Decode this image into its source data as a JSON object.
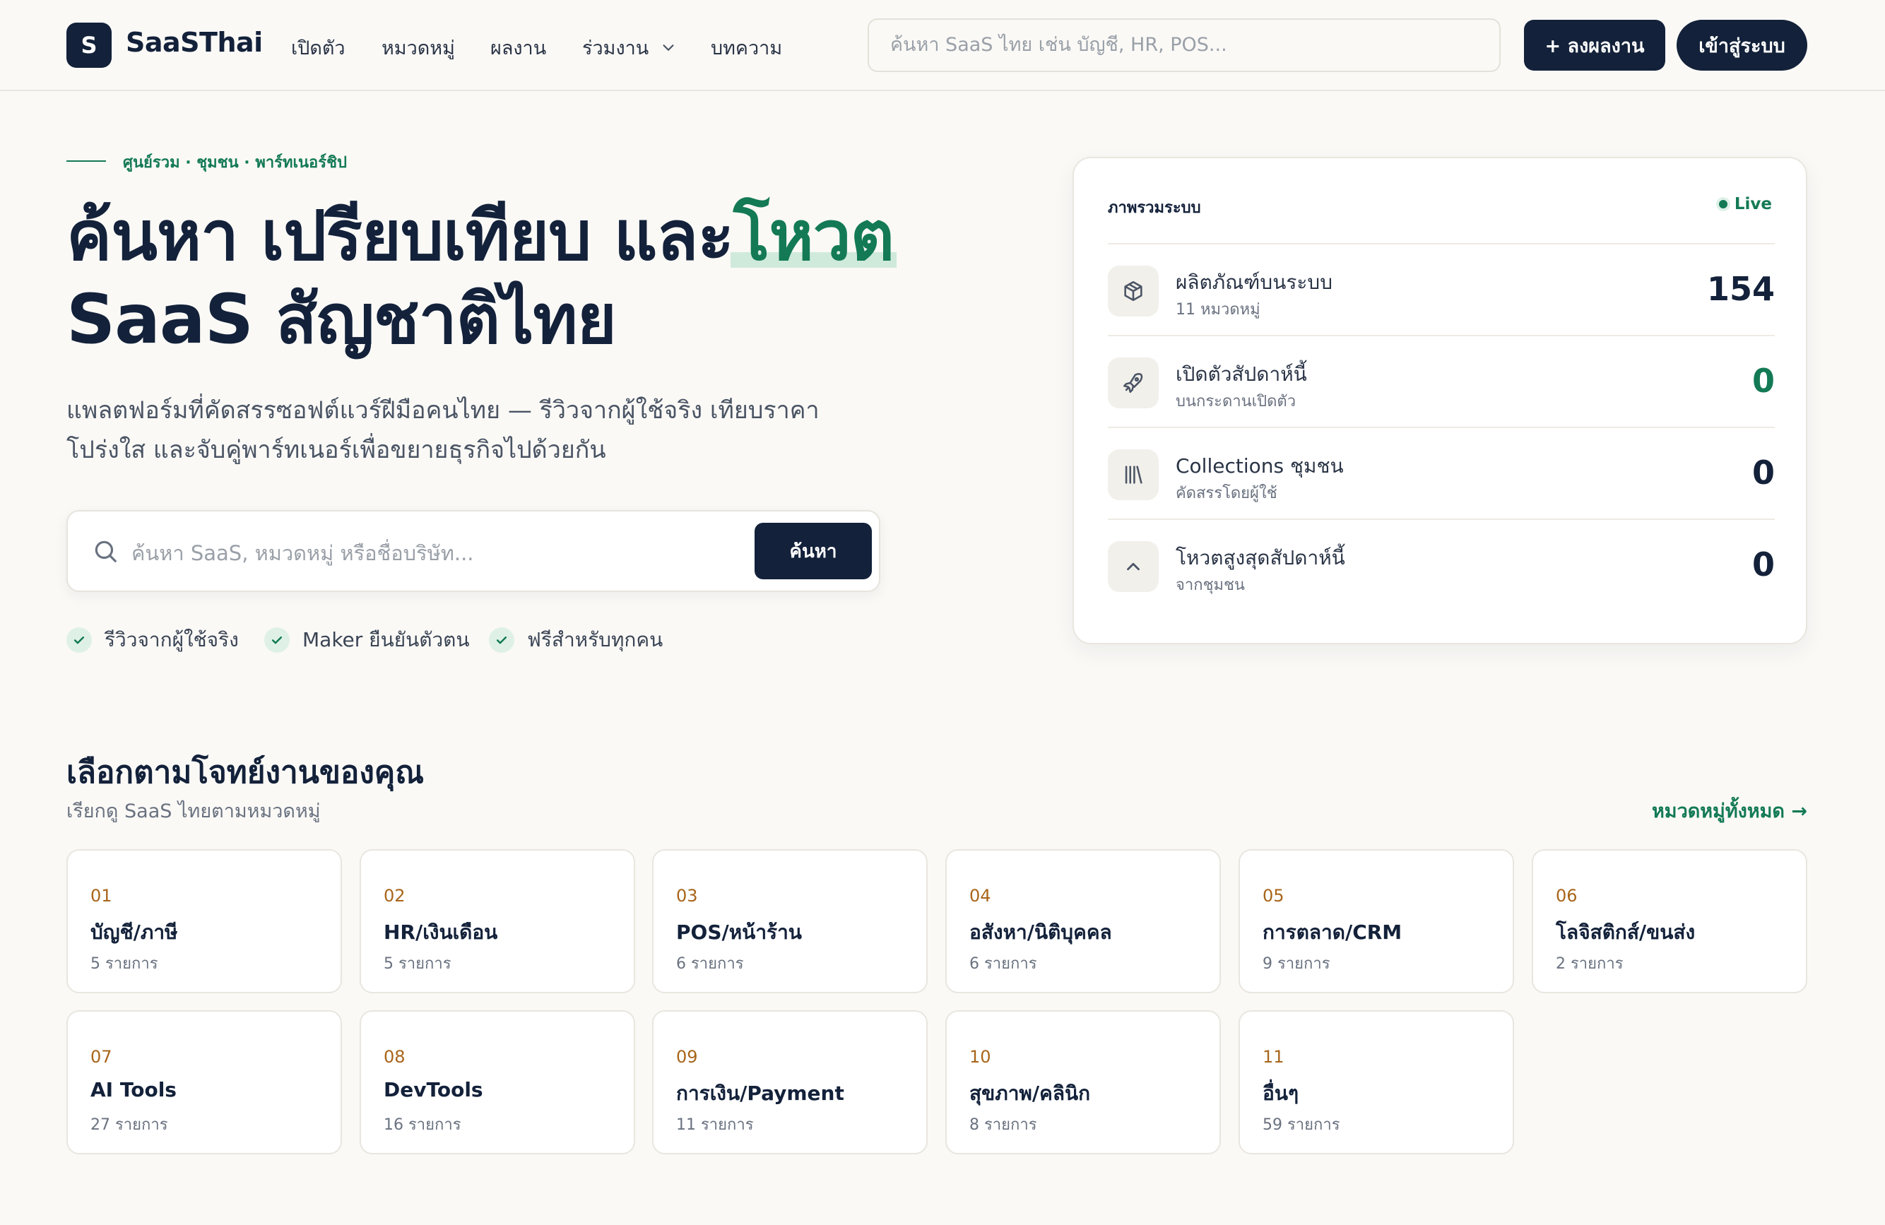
{
  "header": {
    "logo_letter": "S",
    "brand": "SaaSThai",
    "nav": [
      {
        "label": "เปิดตัว"
      },
      {
        "label": "หมวดหมู่"
      },
      {
        "label": "ผลงาน"
      },
      {
        "label": "ร่วมงาน"
      },
      {
        "label": "บทความ"
      }
    ],
    "search_placeholder": "ค้นหา SaaS ไทย เช่น บัญชี, HR, POS...",
    "post_button": "+ ลงผลงาน",
    "login_button": "เข้าสู่ระบบ"
  },
  "hero": {
    "eyebrow": "ศูนย์รวม · ชุมชน · พาร์ทเนอร์ชิป",
    "title_part1": "ค้นหา เปรียบเทียบ และ",
    "title_accent": "โหวต",
    "title_line2": "SaaS สัญชาติไทย",
    "subtitle": "แพลตฟอร์มที่คัดสรรซอฟต์แวร์ฝีมือคนไทย — รีวิวจากผู้ใช้จริง เทียบราคาโปร่งใส และจับคู่พาร์ทเนอร์เพื่อขยายธุรกิจไปด้วยกัน",
    "search_placeholder": "ค้นหา SaaS, หมวดหมู่ หรือชื่อบริษัท...",
    "search_button": "ค้นหา",
    "features": [
      "รีวิวจากผู้ใช้จริง",
      "Maker ยืนยันตัวตน",
      "ฟรีสำหรับทุกคน"
    ]
  },
  "stats": {
    "title": "ภาพรวมระบบ",
    "live": "Live",
    "rows": [
      {
        "label": "ผลิตภัณฑ์บนระบบ",
        "sub": "11 หมวดหมู่",
        "value": "154",
        "icon": "box-icon"
      },
      {
        "label": "เปิดตัวสัปดาห์นี้",
        "sub": "บนกระดานเปิดตัว",
        "value": "0",
        "icon": "rocket-icon"
      },
      {
        "label": "Collections ชุมชน",
        "sub": "คัดสรรโดยผู้ใช้",
        "value": "0",
        "icon": "library-icon"
      },
      {
        "label": "โหวตสูงสุดสัปดาห์นี้",
        "sub": "จากชุมชน",
        "value": "0",
        "icon": "upvote-icon"
      }
    ]
  },
  "categories_section": {
    "title": "เลือกตามโจทย์งานของคุณ",
    "subtitle": "เรียกดู SaaS ไทยตามหมวดหมู่",
    "all_link": "หมวดหมู่ทั้งหมด →",
    "items": [
      {
        "num": "01",
        "name": "บัญชี/ภาษี",
        "count": "5 รายการ"
      },
      {
        "num": "02",
        "name": "HR/เงินเดือน",
        "count": "5 รายการ"
      },
      {
        "num": "03",
        "name": "POS/หน้าร้าน",
        "count": "6 รายการ"
      },
      {
        "num": "04",
        "name": "อสังหา/นิติบุคคล",
        "count": "6 รายการ"
      },
      {
        "num": "05",
        "name": "การตลาด/CRM",
        "count": "9 รายการ"
      },
      {
        "num": "06",
        "name": "โลจิสติกส์/ขนส่ง",
        "count": "2 รายการ"
      },
      {
        "num": "07",
        "name": "AI Tools",
        "count": "27 รายการ"
      },
      {
        "num": "08",
        "name": "DevTools",
        "count": "16 รายการ"
      },
      {
        "num": "09",
        "name": "การเงิน/Payment",
        "count": "11 รายการ"
      },
      {
        "num": "10",
        "name": "สุขภาพ/คลินิก",
        "count": "8 รายการ"
      },
      {
        "num": "11",
        "name": "อื่นๆ",
        "count": "59 รายการ"
      }
    ]
  },
  "colors": {
    "navy": "#13213a",
    "green": "#137a55",
    "amber": "#a8651a",
    "background": "#faf9f6"
  }
}
